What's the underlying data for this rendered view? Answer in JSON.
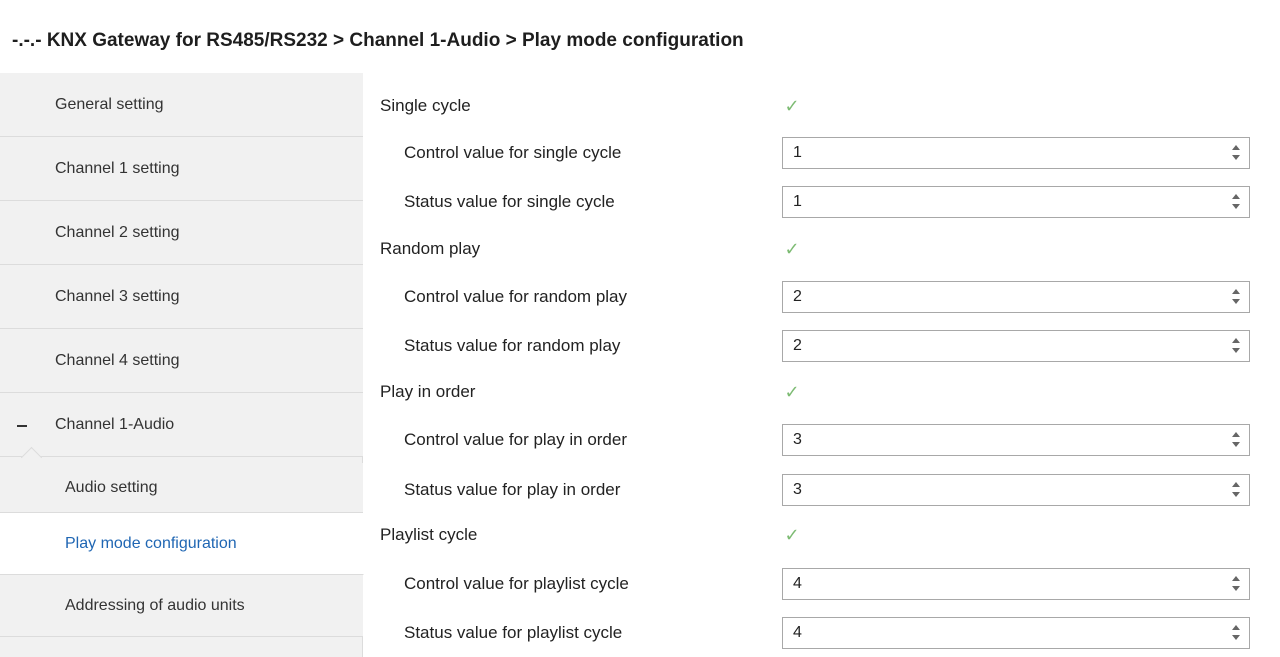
{
  "header": {
    "title": "-.-.- KNX Gateway for RS485/RS232 > Channel 1-Audio > Play mode configuration"
  },
  "sidebar": {
    "items": [
      {
        "label": "General setting"
      },
      {
        "label": "Channel 1 setting"
      },
      {
        "label": "Channel 2 setting"
      },
      {
        "label": "Channel 3 setting"
      },
      {
        "label": "Channel 4 setting"
      },
      {
        "label": "Channel 1-Audio",
        "expanded": true
      },
      {
        "label": "Audio setting"
      },
      {
        "label": "Play mode configuration",
        "active": true
      },
      {
        "label": "Addressing of audio units"
      }
    ]
  },
  "main": {
    "single_cycle": {
      "label": "Single cycle",
      "checked": true,
      "control_label": "Control value for single cycle",
      "control_value": "1",
      "status_label": "Status value for single cycle",
      "status_value": "1"
    },
    "random_play": {
      "label": "Random play",
      "checked": true,
      "control_label": "Control value for random play",
      "control_value": "2",
      "status_label": "Status value for random play",
      "status_value": "2"
    },
    "play_in_order": {
      "label": "Play in order",
      "checked": true,
      "control_label": "Control value for play in order",
      "control_value": "3",
      "status_label": "Status value for play in order",
      "status_value": "3"
    },
    "playlist_cycle": {
      "label": "Playlist cycle",
      "checked": true,
      "control_label": "Control value for playlist cycle",
      "control_value": "4",
      "status_label": "Status value for playlist cycle",
      "status_value": "4"
    }
  },
  "icons": {
    "check": "checkmark-icon",
    "collapse": "minus-icon",
    "spin": "spin-arrows-icon"
  },
  "colors": {
    "active_nav_text": "#1f66b3",
    "check_green": "#7dbb73",
    "sidebar_bg": "#f1f1f1"
  }
}
